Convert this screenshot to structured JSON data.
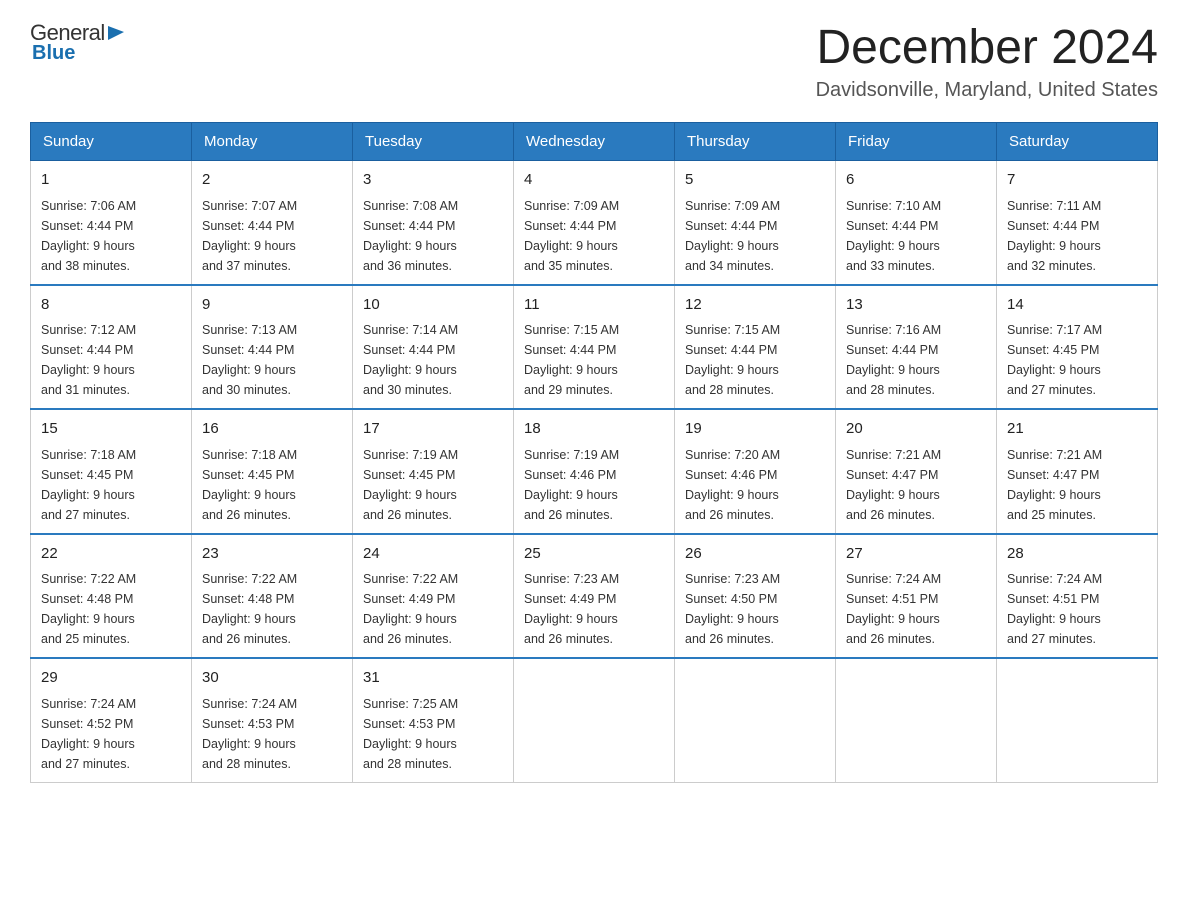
{
  "header": {
    "logo_general": "General",
    "logo_blue": "Blue",
    "title": "December 2024",
    "subtitle": "Davidsonville, Maryland, United States"
  },
  "days_of_week": [
    "Sunday",
    "Monday",
    "Tuesday",
    "Wednesday",
    "Thursday",
    "Friday",
    "Saturday"
  ],
  "weeks": [
    [
      {
        "day": "1",
        "sunrise": "7:06 AM",
        "sunset": "4:44 PM",
        "daylight": "9 hours and 38 minutes."
      },
      {
        "day": "2",
        "sunrise": "7:07 AM",
        "sunset": "4:44 PM",
        "daylight": "9 hours and 37 minutes."
      },
      {
        "day": "3",
        "sunrise": "7:08 AM",
        "sunset": "4:44 PM",
        "daylight": "9 hours and 36 minutes."
      },
      {
        "day": "4",
        "sunrise": "7:09 AM",
        "sunset": "4:44 PM",
        "daylight": "9 hours and 35 minutes."
      },
      {
        "day": "5",
        "sunrise": "7:09 AM",
        "sunset": "4:44 PM",
        "daylight": "9 hours and 34 minutes."
      },
      {
        "day": "6",
        "sunrise": "7:10 AM",
        "sunset": "4:44 PM",
        "daylight": "9 hours and 33 minutes."
      },
      {
        "day": "7",
        "sunrise": "7:11 AM",
        "sunset": "4:44 PM",
        "daylight": "9 hours and 32 minutes."
      }
    ],
    [
      {
        "day": "8",
        "sunrise": "7:12 AM",
        "sunset": "4:44 PM",
        "daylight": "9 hours and 31 minutes."
      },
      {
        "day": "9",
        "sunrise": "7:13 AM",
        "sunset": "4:44 PM",
        "daylight": "9 hours and 30 minutes."
      },
      {
        "day": "10",
        "sunrise": "7:14 AM",
        "sunset": "4:44 PM",
        "daylight": "9 hours and 30 minutes."
      },
      {
        "day": "11",
        "sunrise": "7:15 AM",
        "sunset": "4:44 PM",
        "daylight": "9 hours and 29 minutes."
      },
      {
        "day": "12",
        "sunrise": "7:15 AM",
        "sunset": "4:44 PM",
        "daylight": "9 hours and 28 minutes."
      },
      {
        "day": "13",
        "sunrise": "7:16 AM",
        "sunset": "4:44 PM",
        "daylight": "9 hours and 28 minutes."
      },
      {
        "day": "14",
        "sunrise": "7:17 AM",
        "sunset": "4:45 PM",
        "daylight": "9 hours and 27 minutes."
      }
    ],
    [
      {
        "day": "15",
        "sunrise": "7:18 AM",
        "sunset": "4:45 PM",
        "daylight": "9 hours and 27 minutes."
      },
      {
        "day": "16",
        "sunrise": "7:18 AM",
        "sunset": "4:45 PM",
        "daylight": "9 hours and 26 minutes."
      },
      {
        "day": "17",
        "sunrise": "7:19 AM",
        "sunset": "4:45 PM",
        "daylight": "9 hours and 26 minutes."
      },
      {
        "day": "18",
        "sunrise": "7:19 AM",
        "sunset": "4:46 PM",
        "daylight": "9 hours and 26 minutes."
      },
      {
        "day": "19",
        "sunrise": "7:20 AM",
        "sunset": "4:46 PM",
        "daylight": "9 hours and 26 minutes."
      },
      {
        "day": "20",
        "sunrise": "7:21 AM",
        "sunset": "4:47 PM",
        "daylight": "9 hours and 26 minutes."
      },
      {
        "day": "21",
        "sunrise": "7:21 AM",
        "sunset": "4:47 PM",
        "daylight": "9 hours and 25 minutes."
      }
    ],
    [
      {
        "day": "22",
        "sunrise": "7:22 AM",
        "sunset": "4:48 PM",
        "daylight": "9 hours and 25 minutes."
      },
      {
        "day": "23",
        "sunrise": "7:22 AM",
        "sunset": "4:48 PM",
        "daylight": "9 hours and 26 minutes."
      },
      {
        "day": "24",
        "sunrise": "7:22 AM",
        "sunset": "4:49 PM",
        "daylight": "9 hours and 26 minutes."
      },
      {
        "day": "25",
        "sunrise": "7:23 AM",
        "sunset": "4:49 PM",
        "daylight": "9 hours and 26 minutes."
      },
      {
        "day": "26",
        "sunrise": "7:23 AM",
        "sunset": "4:50 PM",
        "daylight": "9 hours and 26 minutes."
      },
      {
        "day": "27",
        "sunrise": "7:24 AM",
        "sunset": "4:51 PM",
        "daylight": "9 hours and 26 minutes."
      },
      {
        "day": "28",
        "sunrise": "7:24 AM",
        "sunset": "4:51 PM",
        "daylight": "9 hours and 27 minutes."
      }
    ],
    [
      {
        "day": "29",
        "sunrise": "7:24 AM",
        "sunset": "4:52 PM",
        "daylight": "9 hours and 27 minutes."
      },
      {
        "day": "30",
        "sunrise": "7:24 AM",
        "sunset": "4:53 PM",
        "daylight": "9 hours and 28 minutes."
      },
      {
        "day": "31",
        "sunrise": "7:25 AM",
        "sunset": "4:53 PM",
        "daylight": "9 hours and 28 minutes."
      },
      null,
      null,
      null,
      null
    ]
  ],
  "labels": {
    "sunrise": "Sunrise:",
    "sunset": "Sunset:",
    "daylight": "Daylight:"
  }
}
